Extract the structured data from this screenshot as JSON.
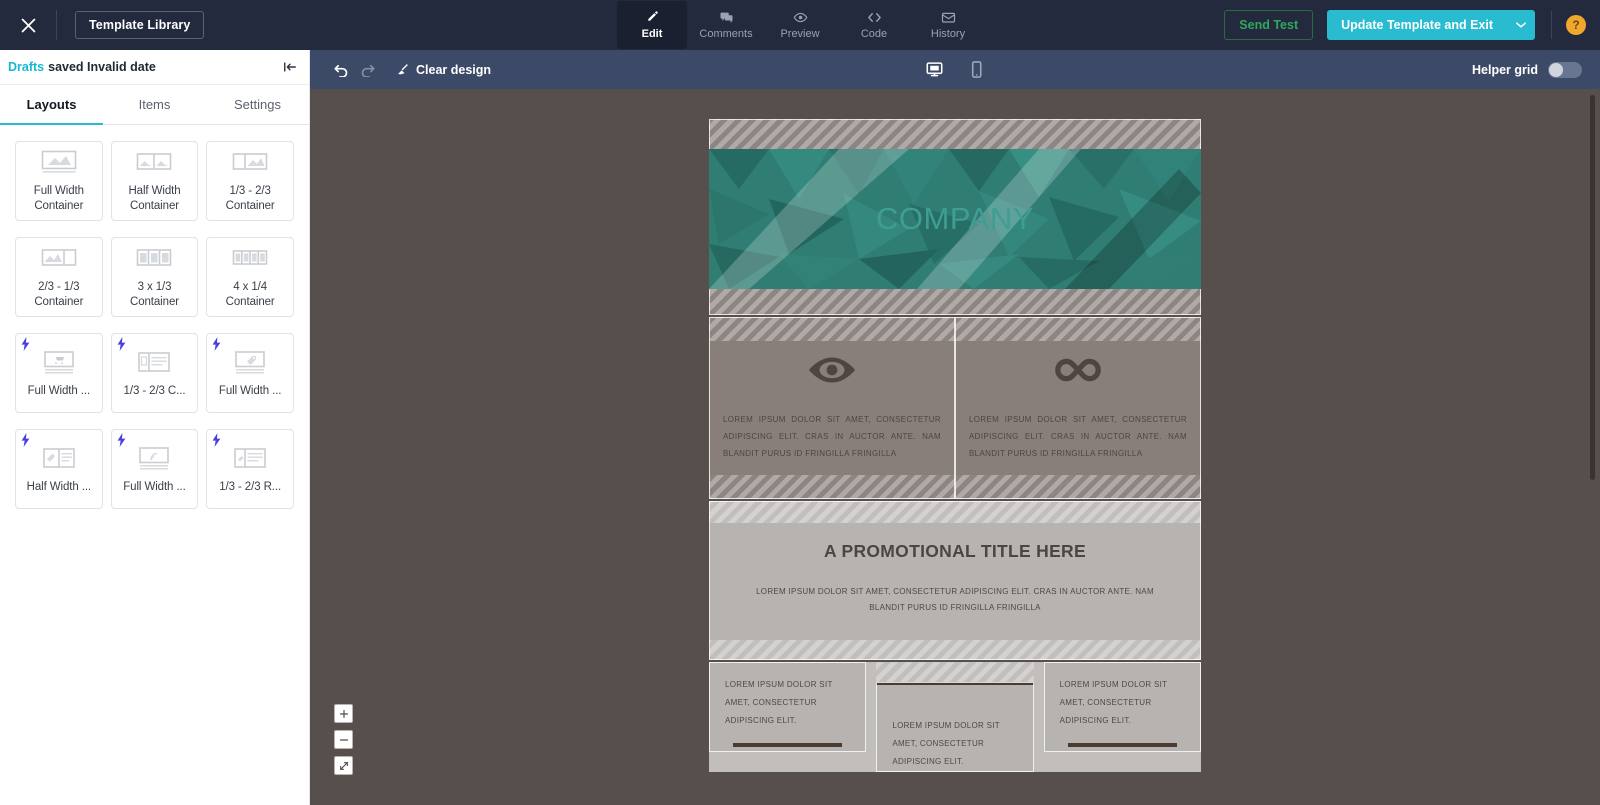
{
  "topbar": {
    "close_label": "close-icon",
    "template_library": "Template Library",
    "modes": [
      {
        "label": "Edit",
        "icon": "pencil-icon",
        "active": true
      },
      {
        "label": "Comments",
        "icon": "comments-icon",
        "active": false
      },
      {
        "label": "Preview",
        "icon": "eye-icon",
        "active": false
      },
      {
        "label": "Code",
        "icon": "code-icon",
        "active": false
      },
      {
        "label": "History",
        "icon": "envelope-icon",
        "active": false
      }
    ],
    "send_test": "Send Test",
    "update_template": "Update Template and Exit",
    "help": "?",
    "accent_color": "#29bcd0",
    "send_test_color": "#2ea85c",
    "help_color": "#f0a72e"
  },
  "sidebar": {
    "draft_status_label": "Drafts",
    "draft_status_text": "saved Invalid date",
    "collapse_icon": "collapse-panel-icon",
    "tabs": [
      {
        "label": "Layouts",
        "active": true
      },
      {
        "label": "Items",
        "active": false
      },
      {
        "label": "Settings",
        "active": false
      }
    ],
    "layouts": [
      {
        "caption": "Full Width\nContainer",
        "thumb": "full-width",
        "dynamic": false
      },
      {
        "caption": "Half Width\nContainer",
        "thumb": "half-width",
        "dynamic": false
      },
      {
        "caption": "1/3 - 2/3\nContainer",
        "thumb": "third-twothird",
        "dynamic": false
      },
      {
        "caption": "2/3 - 1/3\nContainer",
        "thumb": "twothird-third",
        "dynamic": false
      },
      {
        "caption": "3 x 1/3\nContainer",
        "thumb": "three-thirds",
        "dynamic": false
      },
      {
        "caption": "4 x 1/4\nContainer",
        "thumb": "four-quarters",
        "dynamic": false
      },
      {
        "caption": "Full Width ...",
        "thumb": "cart-full-width",
        "dynamic": true
      },
      {
        "caption": "1/3 - 2/3 C...",
        "thumb": "third-twothird-lines",
        "dynamic": true
      },
      {
        "caption": "Full Width ...",
        "thumb": "tag-full-width",
        "dynamic": true
      },
      {
        "caption": "Half Width ...",
        "thumb": "tag-half-width",
        "dynamic": true
      },
      {
        "caption": "Full Width ...",
        "thumb": "rss-full-width",
        "dynamic": true
      },
      {
        "caption": "1/3 - 2/3 R...",
        "thumb": "third-twothird-right",
        "dynamic": true
      }
    ],
    "bolt_color": "#4b3fe0"
  },
  "canvas_toolbar": {
    "undo_icon": "undo-icon",
    "redo_icon": "redo-icon",
    "clear_design": "Clear design",
    "clear_icon": "eraser-icon",
    "desktop_icon": "desktop-icon",
    "mobile_icon": "mobile-icon",
    "helper_grid_label": "Helper grid",
    "helper_grid_on": false,
    "bg_color": "#3c4a68"
  },
  "canvas": {
    "bg_color": "#564f4b",
    "zoom_in": "+",
    "zoom_out": "−",
    "fit_icon": "fit-screen-icon"
  },
  "email": {
    "header": {
      "company_text": "COMPANY",
      "banner_color": "#2e7d72",
      "text_color": "#3f9e94"
    },
    "features": [
      {
        "icon": "eye-icon",
        "text": "LOREM IPSUM DOLOR SIT AMET, CONSECTETUR ADIPISCING ELIT. CRAS IN AUCTOR ANTE. NAM BLANDIT PURUS ID FRINGILLA FRINGILLA"
      },
      {
        "icon": "infinity-icon",
        "text": "LOREM IPSUM DOLOR SIT AMET, CONSECTETUR ADIPISCING ELIT. CRAS IN AUCTOR ANTE. NAM BLANDIT PURUS ID FRINGILLA FRINGILLA"
      }
    ],
    "promo": {
      "title": "A PROMOTIONAL TITLE HERE",
      "subtitle": "LOREM IPSUM DOLOR SIT AMET, CONSECTETUR ADIPISCING ELIT. CRAS IN AUCTOR ANTE. NAM BLANDIT PURUS ID FRINGILLA FRINGILLA"
    },
    "columns": [
      {
        "text": "LOREM IPSUM DOLOR SIT AMET, CONSECTETUR ADIPISCING ELIT."
      },
      {
        "text": "LOREM IPSUM DOLOR SIT AMET, CONSECTETUR ADIPISCING ELIT."
      },
      {
        "text": "LOREM IPSUM DOLOR SIT AMET, CONSECTETUR ADIPISCING ELIT."
      }
    ]
  }
}
